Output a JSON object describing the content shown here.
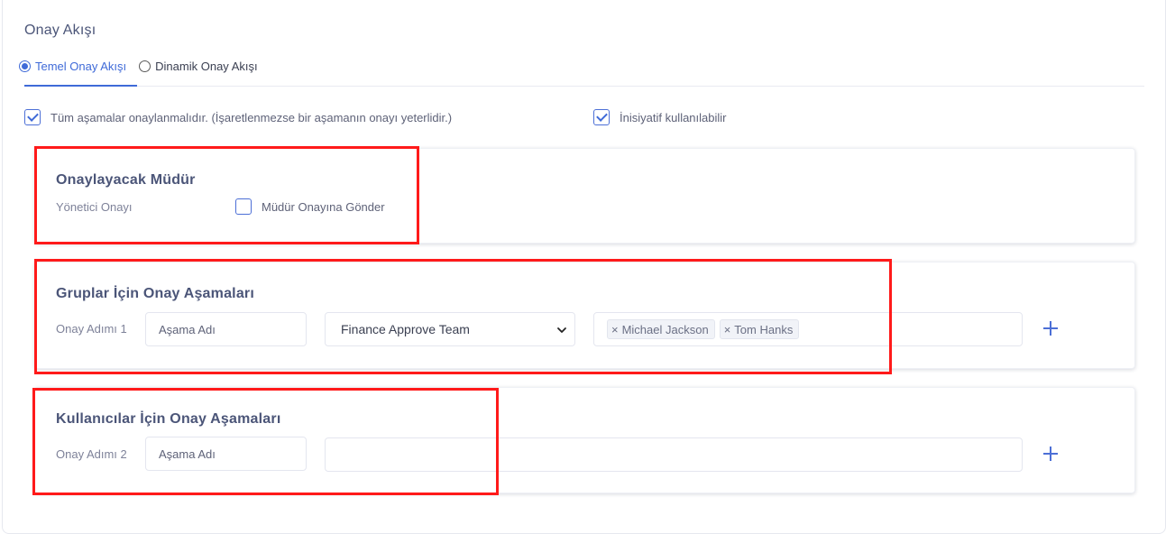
{
  "page": {
    "title": "Onay Akışı"
  },
  "tabs": [
    {
      "label": "Temel Onay Akışı",
      "selected": true
    },
    {
      "label": "Dinamik Onay Akışı",
      "selected": false
    }
  ],
  "options": {
    "all_stages": {
      "label": "Tüm aşamalar onaylanmalıdır. (İşaretlenmezse bir aşamanın onayı yeterlidir.)",
      "checked": true
    },
    "initiative": {
      "label": "İnisiyatif kullanılabilir",
      "checked": true
    }
  },
  "manager_card": {
    "title": "Onaylayacak Müdür",
    "label": "Yönetici Onayı",
    "send_checkbox": {
      "label": "Müdür Onayına Gönder",
      "checked": false
    }
  },
  "groups_card": {
    "title": "Gruplar İçin Onay Aşamaları",
    "step_label": "Onay Adımı 1",
    "stage_name_placeholder": "Aşama Adı",
    "team_select": "Finance Approve Team",
    "tags": [
      "Michael Jackson",
      "Tom Hanks"
    ],
    "tag_remove_glyph": "×"
  },
  "users_card": {
    "title": "Kullanıcılar İçin Onay Aşamaları",
    "step_label": "Onay Adımı 2",
    "stage_name_placeholder": "Aşama Adı",
    "users_value": ""
  },
  "colors": {
    "accent": "#3f6ad8",
    "highlight_box": "#ff1a1a"
  }
}
